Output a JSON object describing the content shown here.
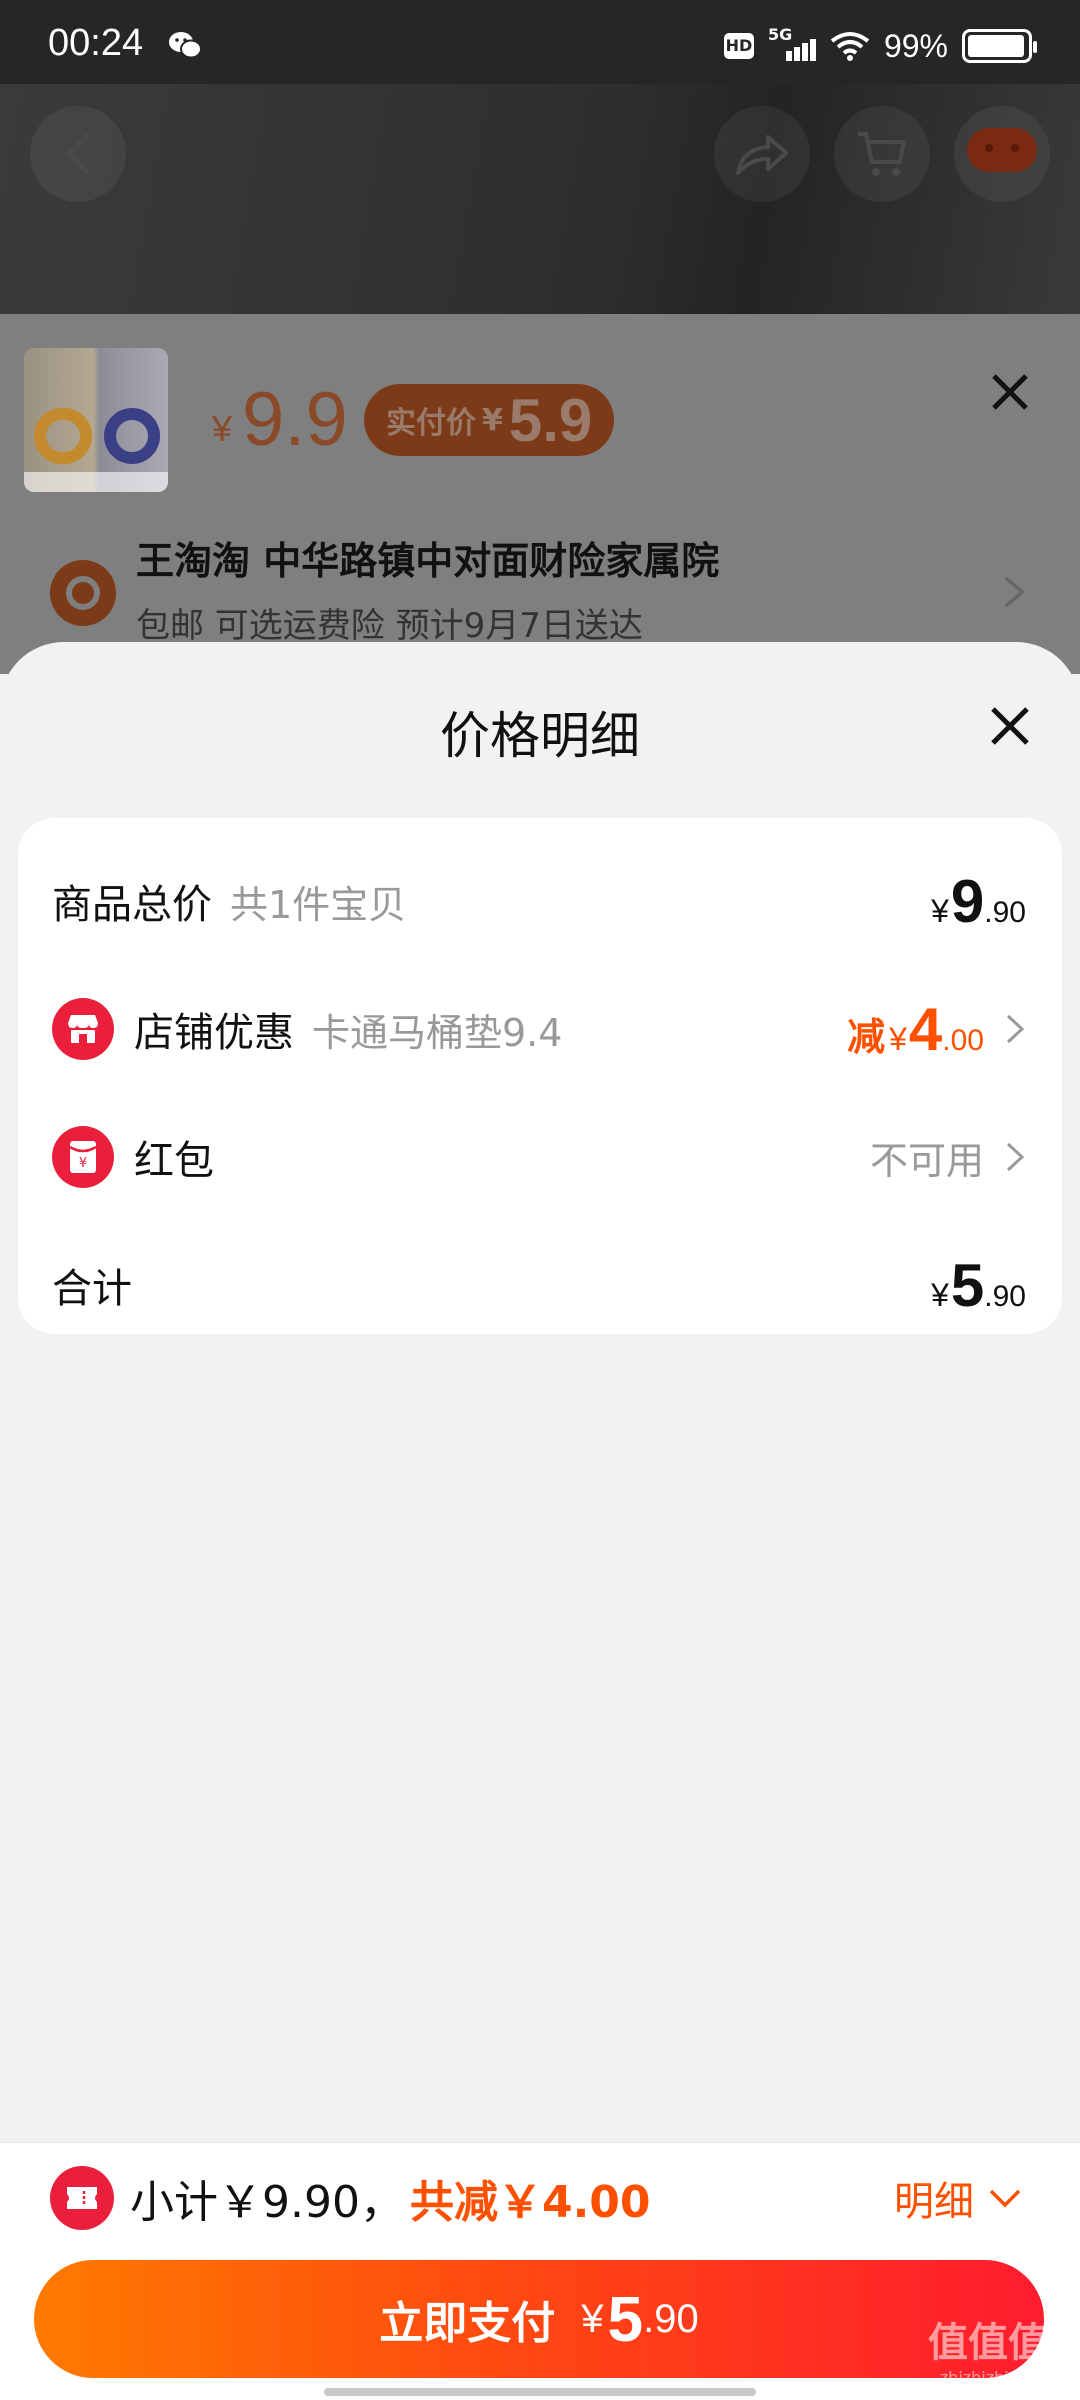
{
  "status_bar": {
    "time": "00:24",
    "network": "5G",
    "hd_badge": "HD",
    "battery": "99%",
    "icons": [
      "wechat-icon",
      "hd-icon",
      "signal-5g-icon",
      "wifi-icon",
      "battery-icon"
    ]
  },
  "product_header": {
    "icons": [
      "back-icon",
      "share-icon",
      "cart-icon",
      "more-icon"
    ]
  },
  "product_summary": {
    "price_symbol": "¥",
    "price": "9.9",
    "real_pay_label": "实付价",
    "real_pay_symbol": "¥",
    "real_pay_amount": "5.9"
  },
  "address": {
    "name": "王淘淘 中华路镇中对面财险家属院",
    "delivery_info": "包邮  可选运费险  预计9月7日送达"
  },
  "sheet": {
    "title": "价格明细",
    "rows": {
      "goods_total": {
        "label": "商品总价",
        "sub": "共1件宝贝",
        "symbol": "¥",
        "int": "9",
        "dec": ".90"
      },
      "store_discount": {
        "label": "店铺优惠",
        "sub": "卡通马桶垫9.4",
        "prefix": "减",
        "symbol": "¥",
        "int": "4",
        "dec": ".00"
      },
      "red_packet": {
        "label": "红包",
        "status": "不可用"
      },
      "total": {
        "label": "合计",
        "symbol": "¥",
        "int": "5",
        "dec": ".90"
      }
    }
  },
  "bottom_bar": {
    "subtotal_text": "小计￥9.90，",
    "saved_text": "共减￥4.00",
    "detail_label": "明细",
    "pay_label": "立即支付",
    "pay_symbol": "¥",
    "pay_int": "5",
    "pay_dec": ".90"
  },
  "watermark": {
    "text": "值值值",
    "sub": "zhizhizhi.com"
  },
  "colors": {
    "accent_orange": "#ff5000",
    "badge_red": "#ea1f3c",
    "pay_gradient_start": "#ff7a00",
    "pay_gradient_end": "#ff1c2e"
  }
}
